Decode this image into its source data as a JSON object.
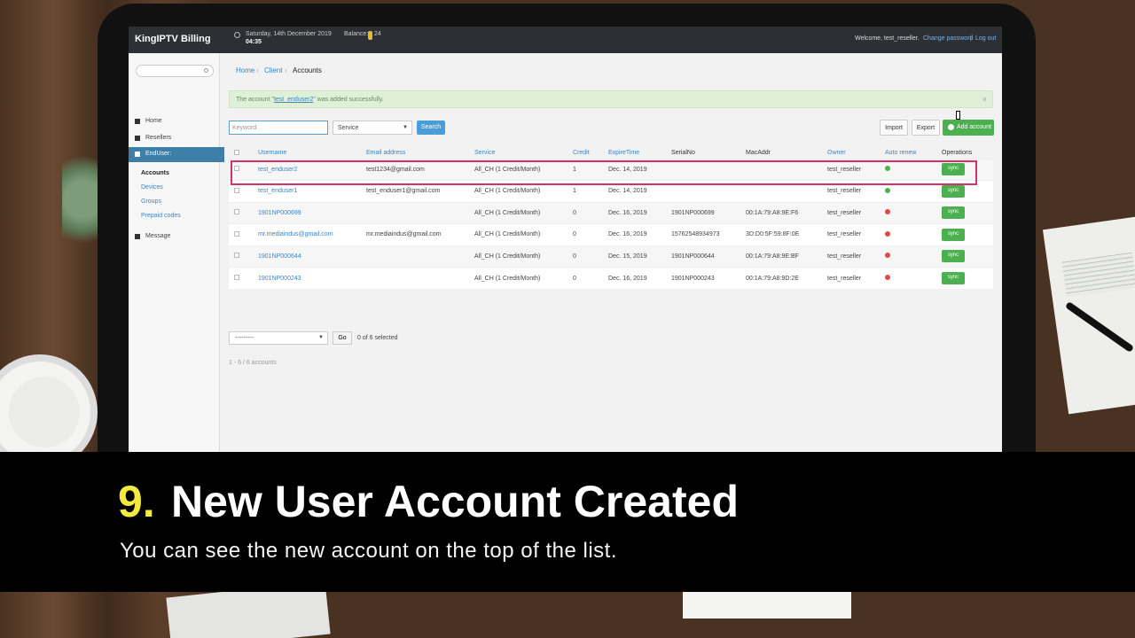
{
  "app": {
    "brand": "KingIPTV Billing",
    "date": "Saturday, 14th December 2019",
    "time": "04:35",
    "balance_label": "Balance:",
    "balance_value": "24",
    "welcome": "Welcome, test_reseller.",
    "change_password": "Change password",
    "separator": "|",
    "logout": "Log out"
  },
  "sidebar": {
    "items": [
      {
        "label": "Home",
        "icon": "home-icon"
      },
      {
        "label": "Resellers",
        "icon": "list-icon"
      },
      {
        "label": "EndUser:",
        "icon": "user-icon"
      },
      {
        "label": "Message",
        "icon": "envelope-icon"
      }
    ],
    "subitems": [
      "Accounts",
      "Devices",
      "Groups",
      "Prepaid codes"
    ]
  },
  "breadcrumb": {
    "home": "Home",
    "client": "Client",
    "current": "Accounts",
    "sep": "›"
  },
  "alert": {
    "prefix": "The account \"",
    "account": "test_enduser2",
    "suffix": "\" was added successfully.",
    "close": "×"
  },
  "filters": {
    "keyword_placeholder": "Keyword",
    "service": "Service",
    "search": "Search",
    "import": "Import",
    "export": "Export",
    "add_account": "Add account"
  },
  "table": {
    "headers": [
      "Username",
      "Email address",
      "Service",
      "Credit",
      "ExpireTime",
      "SerialNo",
      "MacAddr",
      "Owner",
      "Auto renew",
      "Operations"
    ],
    "rows": [
      {
        "username": "test_enduser2",
        "email": "test1234@gmail.com",
        "service": "All_CH (1 Credit/Month)",
        "credit": "1",
        "expire": "Dec. 14, 2019",
        "serial": "",
        "mac": "",
        "owner": "test_reseller",
        "auto": "ok",
        "op": "sync"
      },
      {
        "username": "test_enduser1",
        "email": "test_enduser1@gmail.com",
        "service": "All_CH (1 Credit/Month)",
        "credit": "1",
        "expire": "Dec. 14, 2019",
        "serial": "",
        "mac": "",
        "owner": "test_reseller",
        "auto": "ok",
        "op": "sync"
      },
      {
        "username": "1901NP000699",
        "email": "",
        "service": "All_CH (1 Credit/Month)",
        "credit": "0",
        "expire": "Dec. 16, 2019",
        "serial": "1901NP000699",
        "mac": "00:1A:79:A8:9E:F6",
        "owner": "test_reseller",
        "auto": "no",
        "op": "sync"
      },
      {
        "username": "mr.mediaindus@gmail.com",
        "email": "mr.mediaindus@gmail.com",
        "service": "All_CH (1 Credit/Month)",
        "credit": "0",
        "expire": "Dec. 16, 2019",
        "serial": "15762548934973",
        "mac": "3D:D0:5F:59:8F:0E",
        "owner": "test_reseller",
        "auto": "no",
        "op": "sync"
      },
      {
        "username": "1901NP000644",
        "email": "",
        "service": "All_CH (1 Credit/Month)",
        "credit": "0",
        "expire": "Dec. 15, 2019",
        "serial": "1901NP000644",
        "mac": "00:1A:79:A8:9E:BF",
        "owner": "test_reseller",
        "auto": "no",
        "op": "sync"
      },
      {
        "username": "1901NP000243",
        "email": "",
        "service": "All_CH (1 Credit/Month)",
        "credit": "0",
        "expire": "Dec. 16, 2019",
        "serial": "1901NP000243",
        "mac": "00:1A:79:A8:9D:2E",
        "owner": "test_reseller",
        "auto": "no",
        "op": "sync"
      }
    ]
  },
  "bulk": {
    "action": "---------",
    "go": "Go",
    "selected": "0 of 6 selected"
  },
  "pager": "1 - 6   /   6 accounts",
  "caption": {
    "number": "9.",
    "title": "New User Account Created",
    "subtitle": "You can see the new account on the top of the list."
  },
  "colors": {
    "accent": "#3c84c4",
    "success": "#4caf50",
    "danger": "#e04848",
    "highlight": "#d8306c",
    "caption_number": "#f2ea3c"
  }
}
